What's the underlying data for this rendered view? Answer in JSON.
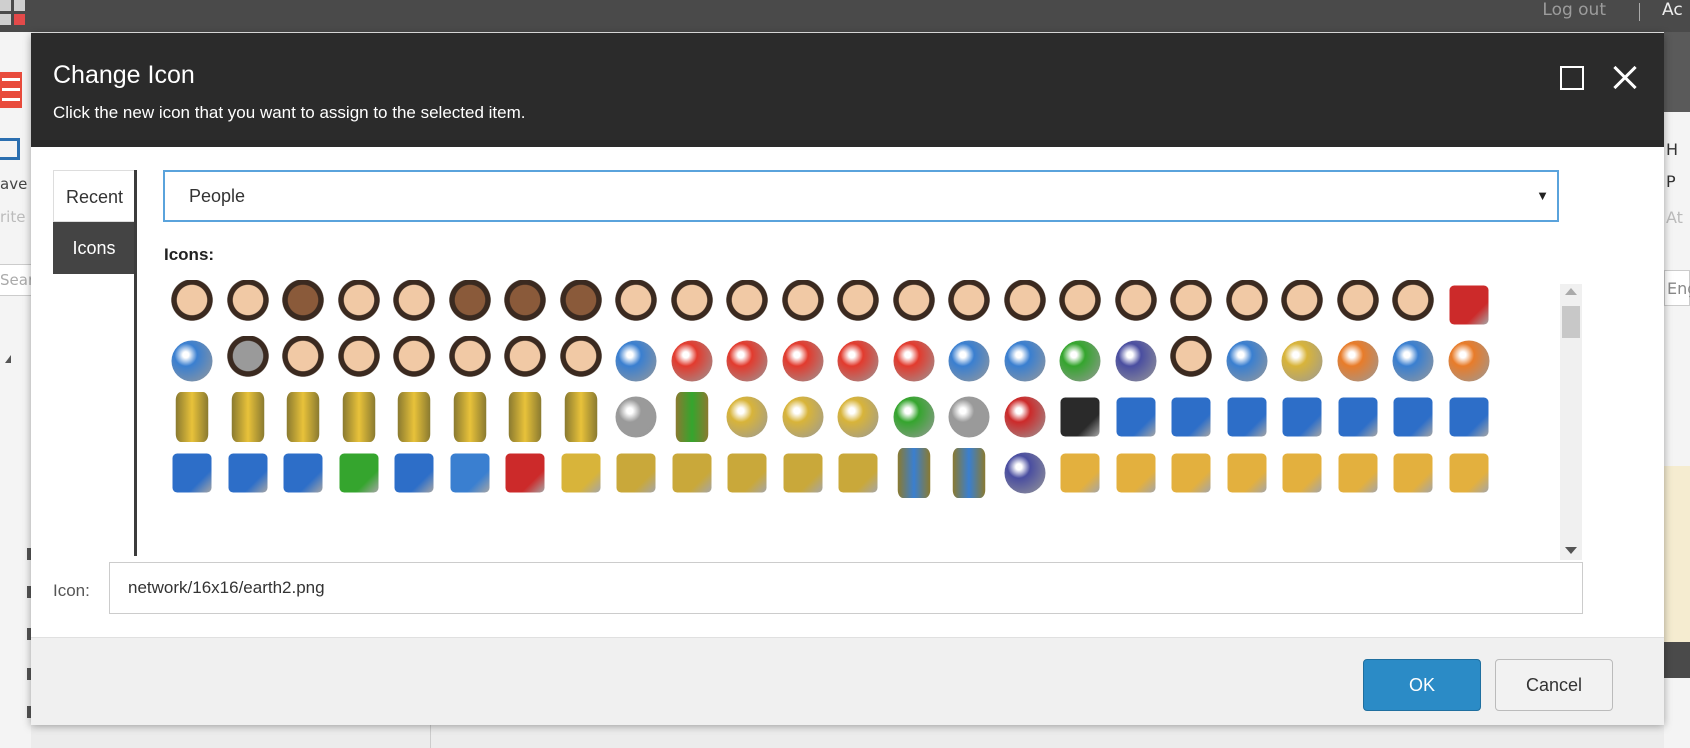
{
  "background": {
    "logout_label": "Log out",
    "user_label": "Ac",
    "save_label": "ave",
    "write_label": "rite",
    "search_placeholder": "Sear",
    "right_items": [
      "H",
      "P",
      "At"
    ],
    "language": "Eng"
  },
  "dialog": {
    "title": "Change Icon",
    "subtitle": "Click the new icon that you want to assign to the selected item.",
    "tabs": {
      "recent": "Recent",
      "icons": "Icons"
    },
    "category": {
      "selected": "People",
      "arrow": "▼"
    },
    "icons_label": "Icons:",
    "icon_field": {
      "label": "Icon:",
      "value": "network/16x16/earth2.png"
    },
    "buttons": {
      "ok": "OK",
      "cancel": "Cancel"
    }
  },
  "icon_rows": [
    [
      "person-woman",
      "person-man-beard",
      "person-man",
      "person-man-glasses",
      "person-man-bald",
      "person-man-long-hair",
      "person-man-smiling",
      "person-man-beard",
      "person-man",
      "person-man",
      "person-man-glasses",
      "person-man-red-beard",
      "person-man",
      "person-man-glasses",
      "person-man-glasses",
      "person-woman",
      "person-man",
      "person-man",
      "person-man",
      "person-man",
      "person-man",
      "person-man-bald",
      "person-man",
      "red-bag"
    ],
    [
      "globe-person",
      "person-anonymous",
      "person-man",
      "person-man",
      "person-man",
      "person-man",
      "person-man",
      "person-man",
      "airplane",
      "alarm-clock",
      "alarm-clock-pause",
      "alarm-clock-check",
      "alarm-clock-play",
      "alarm-clock-stop",
      "ambulance",
      "angel",
      "apple",
      "wizard",
      "person-weight",
      "bug",
      "bananas",
      "bandage",
      "baseball",
      "basketball"
    ],
    [
      "battery",
      "battery-add",
      "battery-find",
      "battery-delete",
      "battery-edit",
      "battery-ok",
      "battery-check",
      "battery-warning",
      "sleeping",
      "beer-bottle",
      "beer-glass",
      "bell",
      "bell-gold",
      "bell-green",
      "bell-gray",
      "bell-red",
      "bible",
      "book-blue",
      "book-blue-add",
      "book-blue-delete",
      "book-blue-edit",
      "book-blue-find",
      "book-blue-new",
      "book-blue-next"
    ],
    [
      "book-blue-check",
      "book-blue-previous",
      "book-blue-search",
      "book-green",
      "book-blue-open",
      "book-open",
      "book-red",
      "book-yellow",
      "books",
      "books-add",
      "books-delete",
      "books-edit",
      "books-check",
      "bottle",
      "bottle-pills",
      "bowling-ball",
      "box",
      "box-add",
      "box-closed",
      "box-add",
      "box-delete",
      "box-edit",
      "box-delete",
      "box-edit"
    ]
  ],
  "icon_colors": {
    "person": "#f1c9a5",
    "person-dark": "#8a5a3a",
    "clock": "#e23b2e",
    "battery": "#e8c23a",
    "book-blue": "#2d6ec8",
    "books": "#c9a83a",
    "box": "#e3b03e",
    "bell": "#d8b43a",
    "green": "#35a52e",
    "red": "#cc2a2a",
    "blue": "#3a7fd0",
    "gray": "#9a9a9a",
    "orange": "#e87c2a"
  }
}
